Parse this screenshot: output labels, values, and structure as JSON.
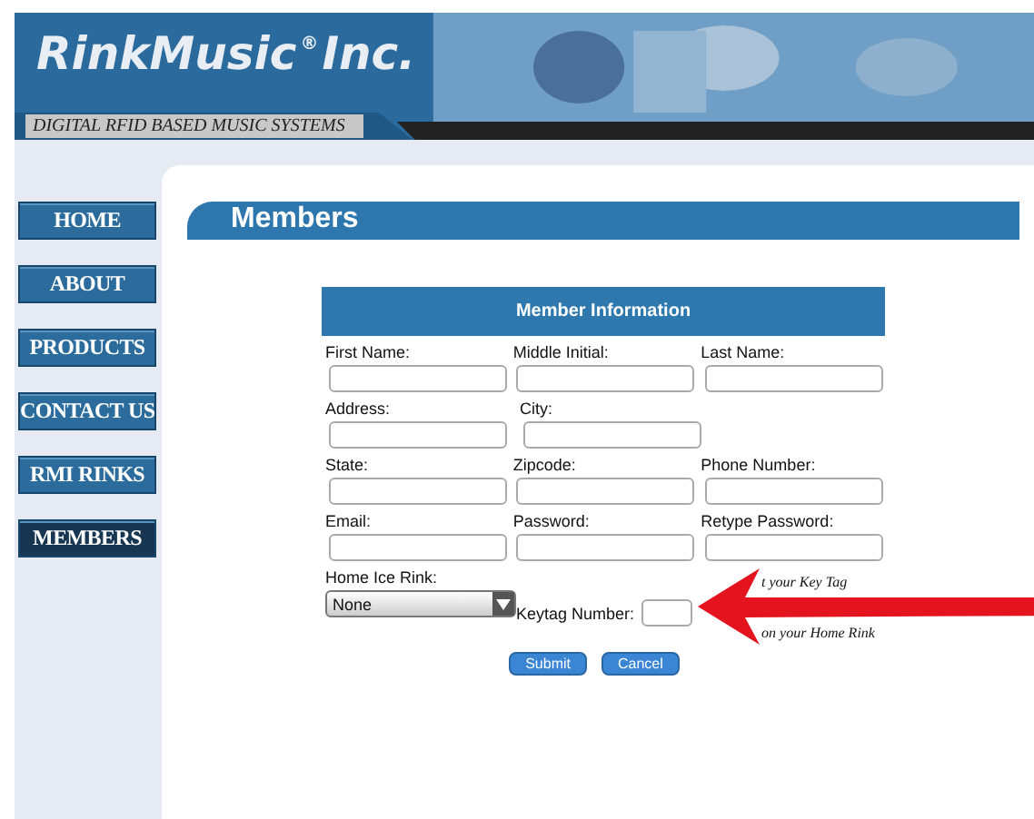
{
  "header": {
    "logo": "RinkMusic",
    "logo_mark": "®",
    "logo_suffix": "Inc.",
    "tagline": "DIGITAL RFID BASED MUSIC SYSTEMS"
  },
  "nav": [
    {
      "label": "HOME",
      "selected": false
    },
    {
      "label": "ABOUT",
      "selected": false
    },
    {
      "label": "PRODUCTS",
      "selected": false
    },
    {
      "label": "CONTACT US",
      "selected": false
    },
    {
      "label": "RMI RINKS",
      "selected": false
    },
    {
      "label": "MEMBERS",
      "selected": true
    }
  ],
  "page_title": "Members",
  "form": {
    "title": "Member Information",
    "rows": [
      [
        {
          "label": "First Name:"
        },
        {
          "label": "Middle Initial:"
        },
        {
          "label": "Last Name:"
        }
      ],
      [
        {
          "label": "Address:"
        },
        {
          "label": "City:"
        }
      ],
      [
        {
          "label": "State:"
        },
        {
          "label": "Zipcode:"
        },
        {
          "label": "Phone Number:"
        }
      ],
      [
        {
          "label": "Email:"
        },
        {
          "label": "Password:"
        },
        {
          "label": "Retype Password:"
        }
      ]
    ],
    "rink": {
      "label": "Home Ice Rink:",
      "value": "None"
    },
    "keytag": {
      "label": "Keytag Number:",
      "hint": [
        "t your Key Tag",
        "on your Home Rink"
      ]
    },
    "buttons": [
      "Submit",
      "Cancel"
    ]
  }
}
